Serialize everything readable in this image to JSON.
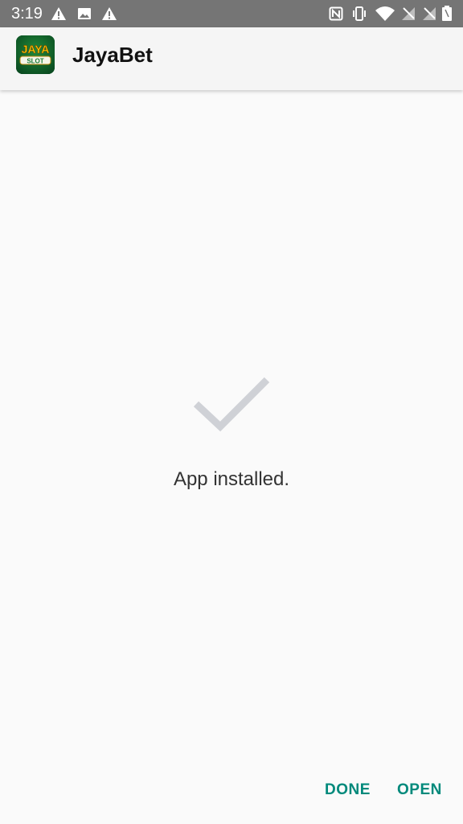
{
  "status_bar": {
    "time": "3:19",
    "background": "#757575",
    "left_icons": [
      "warning-icon",
      "image-icon",
      "warning-icon"
    ],
    "right_icons": [
      "nfc-icon",
      "vibrate-icon",
      "wifi-icon",
      "no-signal-icon",
      "no-signal-icon",
      "battery-icon"
    ]
  },
  "app_bar": {
    "title": "JayaBet",
    "icon_text_top": "JAYA",
    "icon_text_bottom": "SLOT"
  },
  "main": {
    "status_icon": "checkmark-icon",
    "message": "App installed."
  },
  "actions": {
    "done_label": "DONE",
    "open_label": "OPEN",
    "accent_color": "#00897b"
  }
}
